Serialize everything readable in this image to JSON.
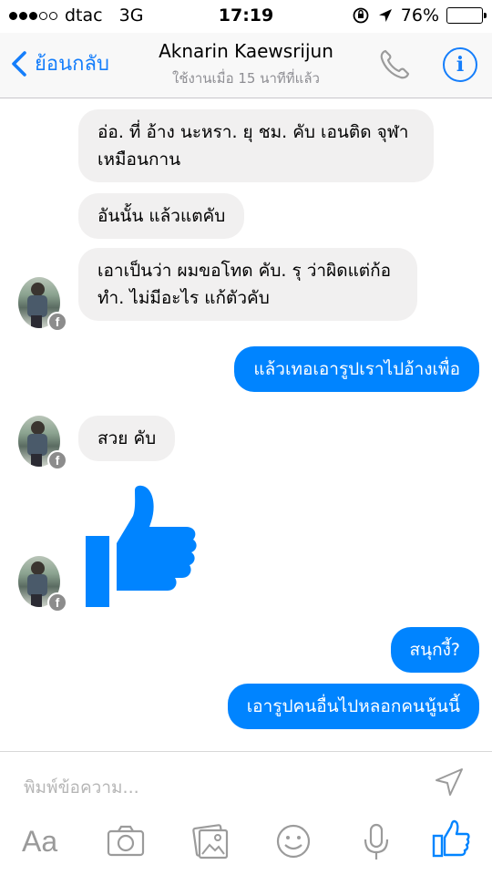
{
  "status_bar": {
    "carrier": "dtac",
    "network": "3G",
    "time": "17:19",
    "battery": "76%",
    "battery_level": 0.76
  },
  "nav": {
    "back_label": "ย้อนกลับ",
    "contact_name": "Aknarin Kaewsrijun",
    "last_active": "ใช้งานเมื่อ 15 นาทีที่แล้ว",
    "info_label": "i"
  },
  "messages": [
    {
      "from": "contact",
      "text_lines": [
        "อ่อ. ที่ อ้าง นะหรา. ยุ ชม. คับ เอนติด จุฬา",
        "เหมือนกาน"
      ]
    },
    {
      "from": "contact",
      "text": "อันนั้น แล้วแตคับ"
    },
    {
      "from": "contact",
      "text_lines": [
        "เอาเป็นว่า ผมขอโทด คับ. รุ ว่าผิดแต่ก้อ",
        "ทำ. ไม่มีอะไร แก้ตัวคับ"
      ]
    },
    {
      "from": "me",
      "text": "แล้วเทอเอารูปเราไปอ้างเพื่อ"
    },
    {
      "from": "contact",
      "text": "สวย คับ"
    },
    {
      "from": "contact",
      "sticker": "like-thumb"
    },
    {
      "from": "me",
      "text": "สนุกงี้?"
    },
    {
      "from": "me",
      "text": "เอารูปคนอื่นไปหลอกคนนู้นนี้"
    }
  ],
  "composer": {
    "placeholder": "พิมพ์ข้อความ...",
    "aa_label": "Aa"
  },
  "colors": {
    "accent": "#157efb",
    "outgoing_bubble": "#0084ff",
    "incoming_bubble": "#f1f0f0"
  },
  "avatar_badge": "f"
}
